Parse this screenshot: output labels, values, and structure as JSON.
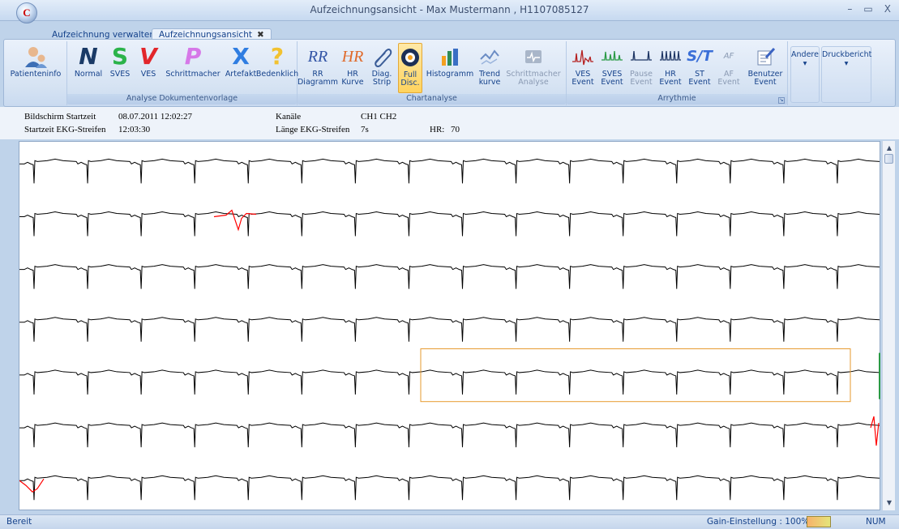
{
  "window": {
    "title": "Aufzeichnungsansicht  -  Max Mustermann , H1107085127",
    "min": "–",
    "max": "▭",
    "close": "X",
    "logo": "C"
  },
  "tabs": [
    {
      "label": "Aufzeichnung verwalten"
    },
    {
      "label": "Aufzeichnungsansicht",
      "close": "✖"
    }
  ],
  "ribbon": {
    "patient": {
      "label": "Patienteninfo"
    },
    "analyse_group": {
      "label": "Analyse Dokumentenvorlage",
      "buttons": [
        {
          "glyph": "N",
          "label": "Normal",
          "color": "#1a3a66"
        },
        {
          "glyph": "S",
          "label": "SVES",
          "color": "#2bb34a"
        },
        {
          "glyph": "V",
          "label": "VES",
          "color": "#e2262b"
        },
        {
          "glyph": "P",
          "label": "Schrittmacher",
          "color": "#d678e8"
        },
        {
          "glyph": "X",
          "label": "Artefakt",
          "color": "#2f7de1"
        },
        {
          "glyph": "?",
          "label": "Bedenklich",
          "color": "#f2c230"
        }
      ]
    },
    "chart_group": {
      "label": "Chartanalyse",
      "buttons": [
        {
          "glyph": "RR",
          "label1": "RR",
          "label2": "Diagramm"
        },
        {
          "glyph": "HR",
          "label1": "HR",
          "label2": "Kurve"
        },
        {
          "label1": "Diag.",
          "label2": "Strip"
        },
        {
          "label1": "Full",
          "label2": "Disc."
        },
        {
          "label1": "Histogramm",
          "label2": ""
        },
        {
          "label1": "Trend",
          "label2": "kurve"
        },
        {
          "label1": "Schrittmacher",
          "label2": "Analyse"
        }
      ]
    },
    "arrhythmia_group": {
      "label": "Arrythmie",
      "buttons": [
        {
          "label1": "VES",
          "label2": "Event"
        },
        {
          "label1": "SVES",
          "label2": "Event"
        },
        {
          "label1": "Pause",
          "label2": "Event"
        },
        {
          "label1": "HR",
          "label2": "Event"
        },
        {
          "label1": "ST",
          "label2": "Event",
          "glyph": "S/T"
        },
        {
          "label1": "AF",
          "label2": "Event",
          "glyph": "AF"
        },
        {
          "label1": "Benutzer",
          "label2": "Event"
        }
      ]
    },
    "andere": {
      "label": "Andere",
      "arrow": "▾"
    },
    "druckbericht": {
      "label": "Druckbericht",
      "arrow": "▾"
    }
  },
  "info": {
    "screen_start_label": "Bildschirm  Startzeit",
    "screen_start_value": "08.07.2011  12:02:27",
    "channels_label": "Kanäle",
    "channels_value": "CH1 CH2",
    "strip_start_label": "Startzeit  EKG-Streifen",
    "strip_start_value": "12:03:30",
    "strip_length_label": "Länge  EKG-Streifen",
    "strip_length_value": "7s",
    "hr_label": "HR:",
    "hr_value": "70"
  },
  "ecg": {
    "rows": 7,
    "beats_per_row": 16,
    "trace_color": "#000000",
    "highlight_color": "#ff0000",
    "selection_color": "#e69a2e"
  },
  "status": {
    "left": "Bereit",
    "gain": "Gain-Einstellung : 100%",
    "num": "NUM"
  }
}
